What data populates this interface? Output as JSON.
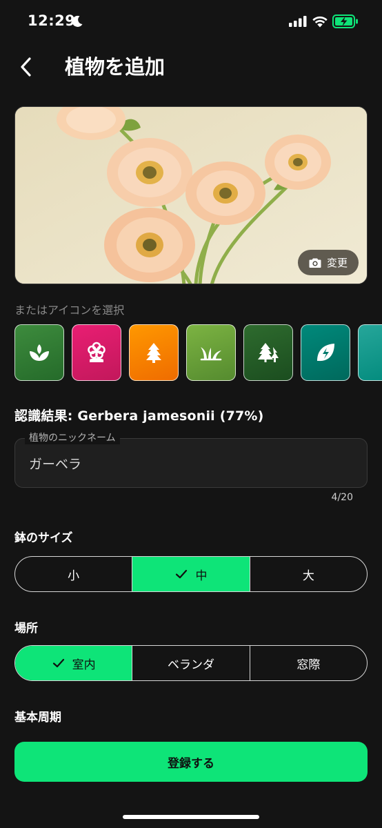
{
  "status_bar": {
    "time": "12:29"
  },
  "header": {
    "title": "植物を追加",
    "back_icon": "chevron-left-icon"
  },
  "photo": {
    "change_label": "変更",
    "change_icon": "camera-icon"
  },
  "icon_picker": {
    "label": "またはアイコンを選択",
    "icons": [
      {
        "name": "sprout-icon",
        "color": "#2e7d32"
      },
      {
        "name": "flower-icon",
        "color": "#d81b60"
      },
      {
        "name": "pine-tree-icon",
        "color": "#f57c00"
      },
      {
        "name": "grass-icon",
        "color": "#689f38"
      },
      {
        "name": "forest-icon",
        "color": "#1b5e20"
      },
      {
        "name": "leaf-icon",
        "color": "#00796b"
      },
      {
        "name": "partial-icon",
        "color": "#009688"
      }
    ]
  },
  "recognition": {
    "text": "認識結果: Gerbera jamesonii (77%)"
  },
  "nickname": {
    "label": "植物のニックネーム",
    "value": "ガーベラ",
    "counter": "4/20"
  },
  "pot_size": {
    "heading": "鉢のサイズ",
    "options": [
      "小",
      "中",
      "大"
    ],
    "selected": "中"
  },
  "location": {
    "heading": "場所",
    "options": [
      "室内",
      "ベランダ",
      "窓際"
    ],
    "selected": "室内"
  },
  "cycle": {
    "heading": "基本周期"
  },
  "register_button": {
    "label": "登録する"
  },
  "colors": {
    "accent": "#0ee478",
    "background": "#141414"
  }
}
